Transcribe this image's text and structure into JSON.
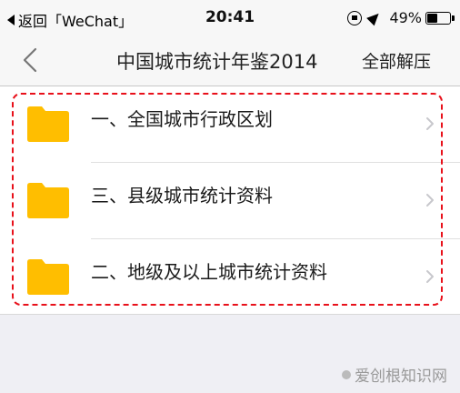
{
  "status_bar": {
    "back_app": "返回「WeChat」",
    "time": "20:41",
    "battery_text": "49%",
    "battery_level": 0.49
  },
  "nav": {
    "title": "中国城市统计年鉴2014",
    "action": "全部解压"
  },
  "list": {
    "items": [
      {
        "label": "一、全国城市行政区划"
      },
      {
        "label": "三、县级城市统计资料"
      },
      {
        "label": "二、地级及以上城市统计资料"
      }
    ]
  },
  "watermark": {
    "text": "爱创根知识网"
  },
  "colors": {
    "folder": "#FFBE00",
    "highlight": "#E8101A",
    "background": "#EFEFF4"
  }
}
